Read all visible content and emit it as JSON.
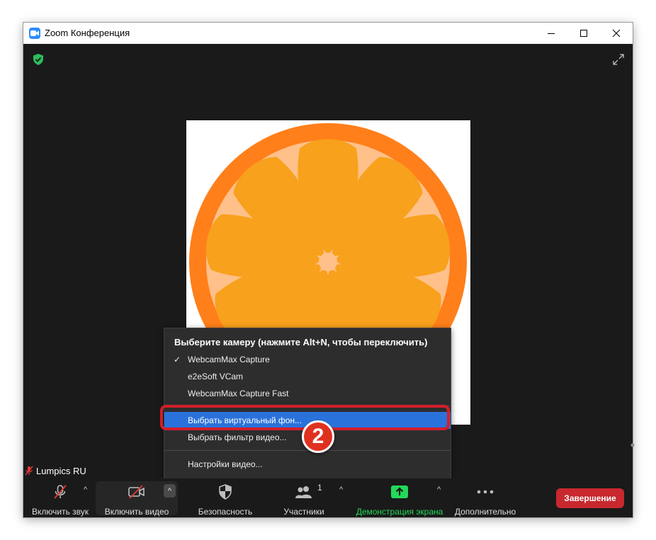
{
  "window": {
    "title": "Zoom Конференция",
    "minimize_glyph": "—",
    "maximize_glyph": "☐",
    "close_glyph": "✕"
  },
  "participant": {
    "name": "Lumpics RU"
  },
  "camera_menu": {
    "header": "Выберите камеру (нажмите Alt+N, чтобы переключить)",
    "cameras": [
      {
        "label": "WebcamMax Capture",
        "checked": true
      },
      {
        "label": "e2eSoft VCam",
        "checked": false
      },
      {
        "label": "WebcamMax Capture Fast",
        "checked": false
      }
    ],
    "check_glyph": "✓",
    "virtual_background": "Выбрать виртуальный фон...",
    "video_filter": "Выбрать фильтр видео...",
    "video_settings": "Настройки видео..."
  },
  "annotation": {
    "step_number": "2"
  },
  "toolbar": {
    "audio_label": "Включить звук",
    "video_label": "Включить видео",
    "security_label": "Безопасность",
    "participants_label": "Участники",
    "participants_count": "1",
    "share_label": "Демонстрация экрана",
    "more_label": "Дополнительно",
    "end_label": "Завершение",
    "caret_glyph": "^"
  },
  "colors": {
    "accent_blue": "#2a72db",
    "share_green": "#23d959",
    "end_red": "#c8282e",
    "annotation_red": "#d21e2b",
    "shield_green": "#2dbb5c",
    "orange_rind": "#ff7f1a",
    "orange_pith": "#ffc08a",
    "orange_segment": "#f7a11c"
  },
  "icons": {
    "app": "zoom-camera-icon",
    "encryption": "shield-check-icon",
    "fullscreen": "expand-icon",
    "muted_mic": "mic-off-icon",
    "video_off": "video-off-icon",
    "security": "shield-icon",
    "participants": "people-icon",
    "share": "share-screen-icon",
    "more": "ellipsis-icon"
  }
}
